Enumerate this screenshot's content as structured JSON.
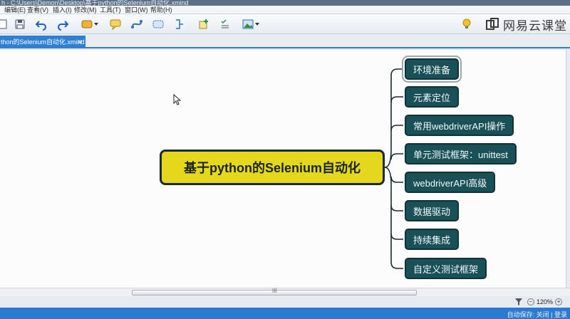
{
  "window": {
    "title": "h - C:\\Users\\Demon\\Desktop\\基于python的Selenium自动化.xmind"
  },
  "menubar": [
    {
      "label": "编辑(E)"
    },
    {
      "label": "查看(V)"
    },
    {
      "label": "插入(I)"
    },
    {
      "label": "修改(M)"
    },
    {
      "label": "工具(T)"
    },
    {
      "label": "窗口(W)"
    },
    {
      "label": "帮助(H)"
    }
  ],
  "toolbar": {
    "icons": [
      "page-icon",
      "save-icon",
      "undo-icon",
      "redo-icon",
      "topic-icon",
      "callout-icon",
      "relationship-icon",
      "boundary-icon",
      "summary-icon",
      "marker-icon",
      "task-icon",
      "image-icon",
      "lightbulb-icon"
    ]
  },
  "watermark": {
    "text": "网易云课堂"
  },
  "tab": {
    "label": "thon的Selenium自动化.xmind",
    "close": "✕"
  },
  "mindmap": {
    "central": "基于python的Selenium自动化",
    "branches": [
      "环境准备",
      "元素定位",
      "常用webdriverAPI操作",
      "单元测试框架：unittest",
      "webdriverAPI高级",
      "数据驱动",
      "持续集成",
      "自定义测试框架"
    ],
    "selected_branch": "环境准备"
  },
  "scrollbar": {
    "grip": "III"
  },
  "status": {
    "zoom": "120%",
    "minus": "−",
    "plus": "+"
  },
  "bottom": {
    "text": "自动保存: 关闭 | 登录"
  },
  "colors": {
    "central_fill": "#e4d71c",
    "node_fill": "#1a5159",
    "tab": "#2f80d2"
  }
}
